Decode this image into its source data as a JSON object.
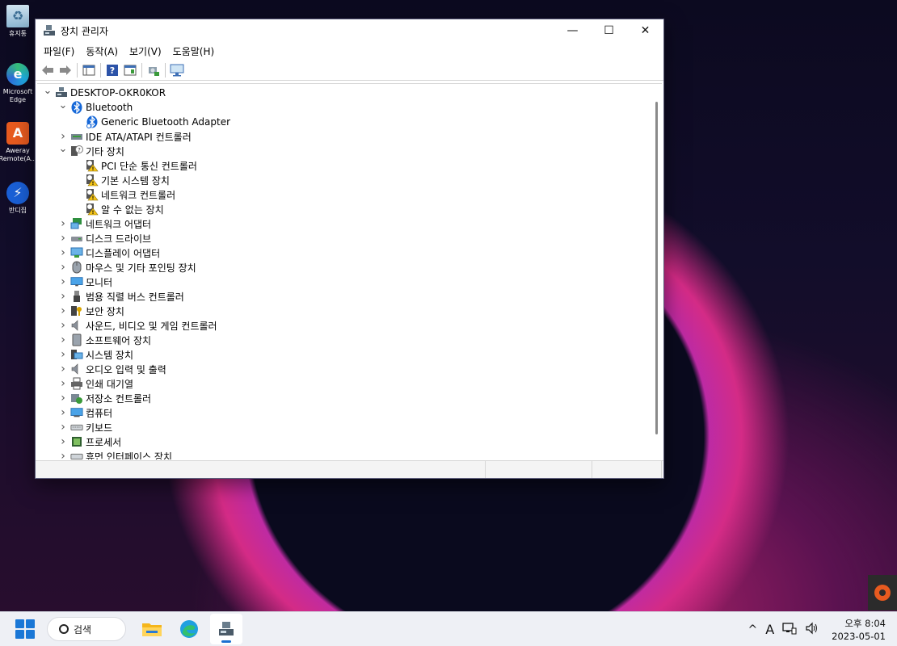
{
  "desktop": {
    "icons": [
      {
        "label": "휴지통",
        "icon": "recycle-bin-icon"
      },
      {
        "label": "Microsoft Edge",
        "icon": "edge-icon"
      },
      {
        "label": "Aweray Remote(A...",
        "icon": "aweray-icon"
      },
      {
        "label": "반디집",
        "icon": "bandizip-icon"
      }
    ]
  },
  "window": {
    "title": "장치 관리자",
    "controls": {
      "minimize": "—",
      "maximize": "☐",
      "close": "✕"
    },
    "menu": [
      "파일(F)",
      "동작(A)",
      "보기(V)",
      "도움말(H)"
    ],
    "toolbar": [
      "back-icon",
      "forward-icon",
      "properties-view-icon",
      "help-icon",
      "action-view-icon",
      "scan-hardware-icon",
      "monitor-icon"
    ],
    "tree": [
      {
        "label": "DESKTOP-OKR0KOR",
        "level": 0,
        "chevron": "down",
        "icon": "computer-root"
      },
      {
        "label": "Bluetooth",
        "level": 1,
        "chevron": "down",
        "icon": "bluetooth"
      },
      {
        "label": "Generic Bluetooth Adapter",
        "level": 2,
        "chevron": "",
        "icon": "bluetooth-device"
      },
      {
        "label": "IDE ATA/ATAPI 컨트롤러",
        "level": 1,
        "chevron": "right",
        "icon": "ide"
      },
      {
        "label": "기타 장치",
        "level": 1,
        "chevron": "down",
        "icon": "unknown"
      },
      {
        "label": "PCI 단순 통신 컨트롤러",
        "level": 2,
        "chevron": "",
        "icon": "warning-device"
      },
      {
        "label": "기본 시스템 장치",
        "level": 2,
        "chevron": "",
        "icon": "warning-device"
      },
      {
        "label": "네트워크 컨트롤러",
        "level": 2,
        "chevron": "",
        "icon": "warning-device"
      },
      {
        "label": "알 수 없는 장치",
        "level": 2,
        "chevron": "",
        "icon": "warning-device"
      },
      {
        "label": "네트워크 어댑터",
        "level": 1,
        "chevron": "right",
        "icon": "network"
      },
      {
        "label": "디스크 드라이브",
        "level": 1,
        "chevron": "right",
        "icon": "disk"
      },
      {
        "label": "디스플레이 어댑터",
        "level": 1,
        "chevron": "right",
        "icon": "display"
      },
      {
        "label": "마우스 및 기타 포인팅 장치",
        "level": 1,
        "chevron": "right",
        "icon": "mouse"
      },
      {
        "label": "모니터",
        "level": 1,
        "chevron": "right",
        "icon": "monitor"
      },
      {
        "label": "범용 직렬 버스 컨트롤러",
        "level": 1,
        "chevron": "right",
        "icon": "usb"
      },
      {
        "label": "보안 장치",
        "level": 1,
        "chevron": "right",
        "icon": "security"
      },
      {
        "label": "사운드, 비디오 및 게임 컨트롤러",
        "level": 1,
        "chevron": "right",
        "icon": "sound"
      },
      {
        "label": "소프트웨어 장치",
        "level": 1,
        "chevron": "right",
        "icon": "software"
      },
      {
        "label": "시스템 장치",
        "level": 1,
        "chevron": "right",
        "icon": "system"
      },
      {
        "label": "오디오 입력 및 출력",
        "level": 1,
        "chevron": "right",
        "icon": "sound"
      },
      {
        "label": "인쇄 대기열",
        "level": 1,
        "chevron": "right",
        "icon": "printer"
      },
      {
        "label": "저장소 컨트롤러",
        "level": 1,
        "chevron": "right",
        "icon": "storage"
      },
      {
        "label": "컴퓨터",
        "level": 1,
        "chevron": "right",
        "icon": "computer"
      },
      {
        "label": "키보드",
        "level": 1,
        "chevron": "right",
        "icon": "keyboard"
      },
      {
        "label": "프로세서",
        "level": 1,
        "chevron": "right",
        "icon": "processor"
      },
      {
        "label": "휴먼 인터페이스 장치",
        "level": 1,
        "chevron": "right",
        "icon": "hid"
      }
    ]
  },
  "taskbar": {
    "search_label": "검색",
    "apps": [
      "file-explorer-icon",
      "edge-icon",
      "device-manager-icon"
    ],
    "tray": {
      "chevron": "^",
      "ime": "A"
    },
    "clock": {
      "time": "오후 8:04",
      "date": "2023-05-01"
    }
  }
}
